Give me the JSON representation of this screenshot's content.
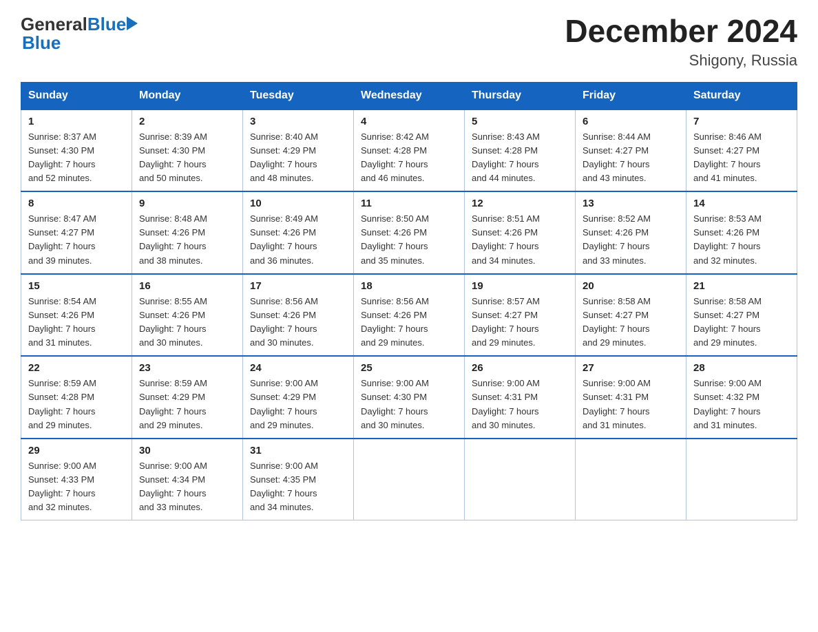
{
  "header": {
    "logo_general": "General",
    "logo_blue": "Blue",
    "title": "December 2024",
    "subtitle": "Shigony, Russia"
  },
  "weekdays": [
    "Sunday",
    "Monday",
    "Tuesday",
    "Wednesday",
    "Thursday",
    "Friday",
    "Saturday"
  ],
  "weeks": [
    [
      {
        "day": "1",
        "info": "Sunrise: 8:37 AM\nSunset: 4:30 PM\nDaylight: 7 hours\nand 52 minutes."
      },
      {
        "day": "2",
        "info": "Sunrise: 8:39 AM\nSunset: 4:30 PM\nDaylight: 7 hours\nand 50 minutes."
      },
      {
        "day": "3",
        "info": "Sunrise: 8:40 AM\nSunset: 4:29 PM\nDaylight: 7 hours\nand 48 minutes."
      },
      {
        "day": "4",
        "info": "Sunrise: 8:42 AM\nSunset: 4:28 PM\nDaylight: 7 hours\nand 46 minutes."
      },
      {
        "day": "5",
        "info": "Sunrise: 8:43 AM\nSunset: 4:28 PM\nDaylight: 7 hours\nand 44 minutes."
      },
      {
        "day": "6",
        "info": "Sunrise: 8:44 AM\nSunset: 4:27 PM\nDaylight: 7 hours\nand 43 minutes."
      },
      {
        "day": "7",
        "info": "Sunrise: 8:46 AM\nSunset: 4:27 PM\nDaylight: 7 hours\nand 41 minutes."
      }
    ],
    [
      {
        "day": "8",
        "info": "Sunrise: 8:47 AM\nSunset: 4:27 PM\nDaylight: 7 hours\nand 39 minutes."
      },
      {
        "day": "9",
        "info": "Sunrise: 8:48 AM\nSunset: 4:26 PM\nDaylight: 7 hours\nand 38 minutes."
      },
      {
        "day": "10",
        "info": "Sunrise: 8:49 AM\nSunset: 4:26 PM\nDaylight: 7 hours\nand 36 minutes."
      },
      {
        "day": "11",
        "info": "Sunrise: 8:50 AM\nSunset: 4:26 PM\nDaylight: 7 hours\nand 35 minutes."
      },
      {
        "day": "12",
        "info": "Sunrise: 8:51 AM\nSunset: 4:26 PM\nDaylight: 7 hours\nand 34 minutes."
      },
      {
        "day": "13",
        "info": "Sunrise: 8:52 AM\nSunset: 4:26 PM\nDaylight: 7 hours\nand 33 minutes."
      },
      {
        "day": "14",
        "info": "Sunrise: 8:53 AM\nSunset: 4:26 PM\nDaylight: 7 hours\nand 32 minutes."
      }
    ],
    [
      {
        "day": "15",
        "info": "Sunrise: 8:54 AM\nSunset: 4:26 PM\nDaylight: 7 hours\nand 31 minutes."
      },
      {
        "day": "16",
        "info": "Sunrise: 8:55 AM\nSunset: 4:26 PM\nDaylight: 7 hours\nand 30 minutes."
      },
      {
        "day": "17",
        "info": "Sunrise: 8:56 AM\nSunset: 4:26 PM\nDaylight: 7 hours\nand 30 minutes."
      },
      {
        "day": "18",
        "info": "Sunrise: 8:56 AM\nSunset: 4:26 PM\nDaylight: 7 hours\nand 29 minutes."
      },
      {
        "day": "19",
        "info": "Sunrise: 8:57 AM\nSunset: 4:27 PM\nDaylight: 7 hours\nand 29 minutes."
      },
      {
        "day": "20",
        "info": "Sunrise: 8:58 AM\nSunset: 4:27 PM\nDaylight: 7 hours\nand 29 minutes."
      },
      {
        "day": "21",
        "info": "Sunrise: 8:58 AM\nSunset: 4:27 PM\nDaylight: 7 hours\nand 29 minutes."
      }
    ],
    [
      {
        "day": "22",
        "info": "Sunrise: 8:59 AM\nSunset: 4:28 PM\nDaylight: 7 hours\nand 29 minutes."
      },
      {
        "day": "23",
        "info": "Sunrise: 8:59 AM\nSunset: 4:29 PM\nDaylight: 7 hours\nand 29 minutes."
      },
      {
        "day": "24",
        "info": "Sunrise: 9:00 AM\nSunset: 4:29 PM\nDaylight: 7 hours\nand 29 minutes."
      },
      {
        "day": "25",
        "info": "Sunrise: 9:00 AM\nSunset: 4:30 PM\nDaylight: 7 hours\nand 30 minutes."
      },
      {
        "day": "26",
        "info": "Sunrise: 9:00 AM\nSunset: 4:31 PM\nDaylight: 7 hours\nand 30 minutes."
      },
      {
        "day": "27",
        "info": "Sunrise: 9:00 AM\nSunset: 4:31 PM\nDaylight: 7 hours\nand 31 minutes."
      },
      {
        "day": "28",
        "info": "Sunrise: 9:00 AM\nSunset: 4:32 PM\nDaylight: 7 hours\nand 31 minutes."
      }
    ],
    [
      {
        "day": "29",
        "info": "Sunrise: 9:00 AM\nSunset: 4:33 PM\nDaylight: 7 hours\nand 32 minutes."
      },
      {
        "day": "30",
        "info": "Sunrise: 9:00 AM\nSunset: 4:34 PM\nDaylight: 7 hours\nand 33 minutes."
      },
      {
        "day": "31",
        "info": "Sunrise: 9:00 AM\nSunset: 4:35 PM\nDaylight: 7 hours\nand 34 minutes."
      },
      {
        "day": "",
        "info": ""
      },
      {
        "day": "",
        "info": ""
      },
      {
        "day": "",
        "info": ""
      },
      {
        "day": "",
        "info": ""
      }
    ]
  ]
}
